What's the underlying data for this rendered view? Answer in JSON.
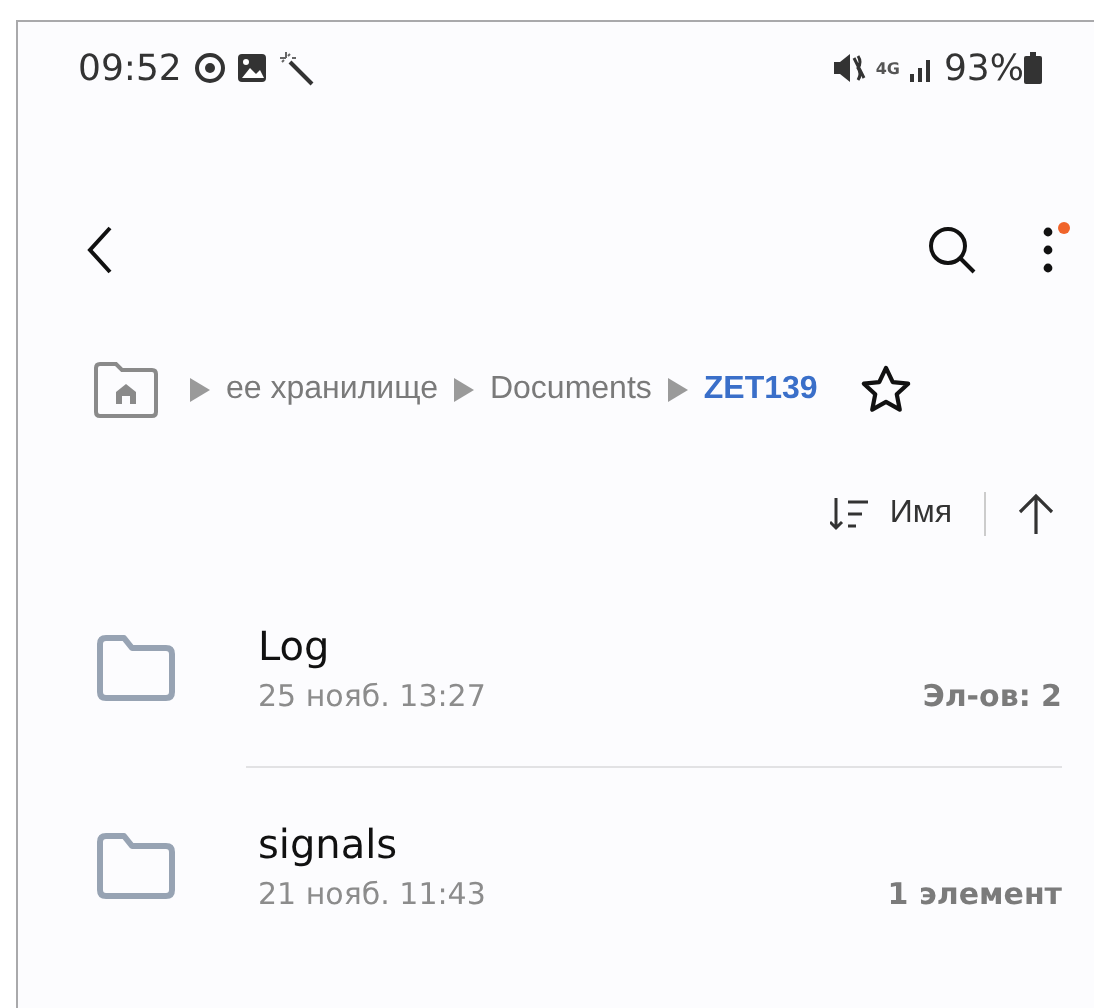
{
  "status_bar": {
    "time": "09:52",
    "network": "4G",
    "battery": "93%"
  },
  "toolbar": {
    "menu_dot": true
  },
  "breadcrumb": {
    "items": [
      {
        "label": "ее хранилище",
        "selected": false
      },
      {
        "label": "Documents",
        "selected": false
      },
      {
        "label": "ZET139",
        "selected": true
      }
    ],
    "favorite": false
  },
  "sort": {
    "label": "Имя"
  },
  "files": [
    {
      "name": "Log",
      "date": "25 нояб. 13:27",
      "count": "Эл-ов: 2"
    },
    {
      "name": "signals",
      "date": "21 нояб. 11:43",
      "count": "1 элемент"
    }
  ]
}
